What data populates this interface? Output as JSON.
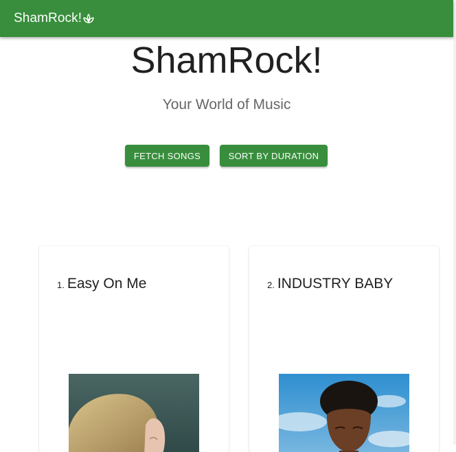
{
  "appbar": {
    "brand": "ShamRock!",
    "icon": "spa-leaf-icon"
  },
  "hero": {
    "title": "ShamRock!",
    "subtitle": "Your World of Music"
  },
  "actions": {
    "fetch_label": "FETCH SONGS",
    "sort_label": "SORT BY DURATION"
  },
  "colors": {
    "primary": "#388e3c",
    "text": "#212121",
    "subtext": "#666666"
  },
  "songs": [
    {
      "number": "1.",
      "title": "Easy On Me",
      "cover": "album-cover-image"
    },
    {
      "number": "2.",
      "title": "INDUSTRY BABY",
      "cover": "album-cover-image"
    }
  ]
}
